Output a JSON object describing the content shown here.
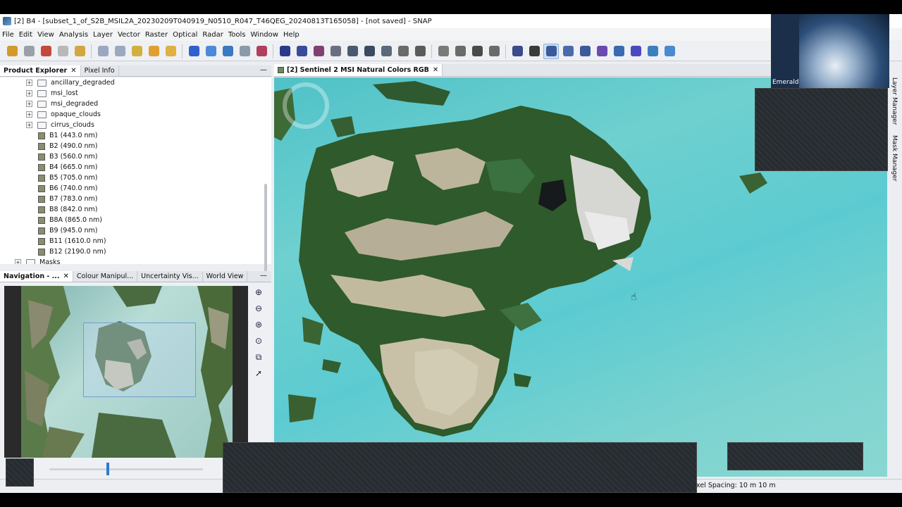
{
  "window": {
    "title": "[2] B4 - [subset_1_of_S2B_MSIL2A_20230209T040919_N0510_R047_T46QEG_20240813T165058] - [not saved] - SNAP"
  },
  "menu": [
    "File",
    "Edit",
    "View",
    "Analysis",
    "Layer",
    "Vector",
    "Raster",
    "Optical",
    "Radar",
    "Tools",
    "Window",
    "Help"
  ],
  "toolbar": {
    "colors": [
      "#d39a2a",
      "#9aa0a8",
      "#c24a3a",
      "#b8b8b8",
      "#d2a640",
      "#9aa8c0",
      "#9aa8c0",
      "#d2b040",
      "#e0a030",
      "#e0b040",
      "#3060d0",
      "#4a8ad8",
      "#3a7ac0",
      "#8a9aa8",
      "#b04060",
      "#2a3a8a",
      "#3a4a9a",
      "#804070",
      "#6a7080",
      "#4a5a70",
      "#3a4a60",
      "#5a6a7a",
      "#6a6a6a",
      "#5a5a5a",
      "#7a7a7a",
      "#6a6a6a",
      "#4a4a4a",
      "#6a6a6a",
      "#3a4a8a",
      "#3a3a3a",
      "#3a5a9a",
      "#4a6aaa",
      "#3a5a9a",
      "#6a4ab0",
      "#3a6ab0",
      "#4a4ac0",
      "#3a80c0",
      "#4a8ad0"
    ]
  },
  "product_explorer": {
    "tabs": [
      "Product Explorer",
      "Pixel Info"
    ],
    "folders": [
      "ancillary_degraded",
      "msi_lost",
      "msi_degraded",
      "opaque_clouds",
      "cirrus_clouds"
    ],
    "bands": [
      "B1 (443.0 nm)",
      "B2 (490.0 nm)",
      "B3 (560.0 nm)",
      "B4 (665.0 nm)",
      "B5 (705.0 nm)",
      "B6 (740.0 nm)",
      "B7 (783.0 nm)",
      "B8 (842.0 nm)",
      "B8A (865.0 nm)",
      "B9 (945.0 nm)",
      "B11 (1610.0 nm)",
      "B12 (2190.0 nm)"
    ],
    "masks": "Masks"
  },
  "navigation": {
    "tabs": [
      "Navigation - ...",
      "Colour Manipul...",
      "Uncertainty Vis...",
      "World View"
    ],
    "zoom_icons": [
      "zoom-in-icon",
      "zoom-out-icon",
      "zoom-pixel-icon",
      "zoom-all-icon",
      "sync-views-icon",
      "sync-cursor-icon"
    ],
    "slider_level": 0.38
  },
  "image_view": {
    "tab": "[2] Sentinel 2 MSI Natural Colors RGB"
  },
  "side_tabs": [
    "Layer Manager",
    "Mask Manager"
  ],
  "status": {
    "pixel_spacing": "xel Spacing: 10 m 10 m"
  },
  "webcam": {
    "name": "Emerald"
  }
}
